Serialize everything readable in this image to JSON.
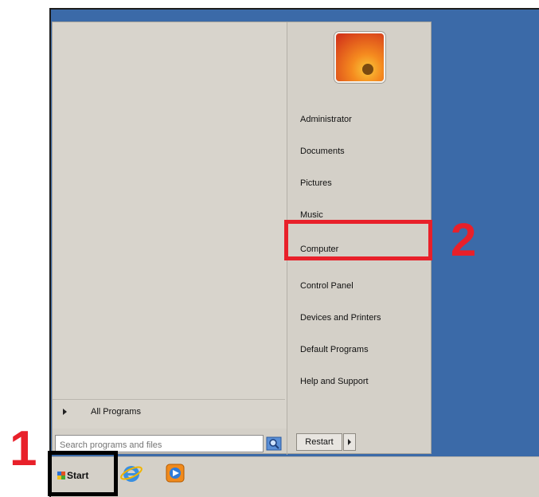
{
  "start_menu": {
    "user_tile_name": "picture-flower",
    "all_programs_label": "All Programs",
    "search_placeholder": "Search programs and files",
    "right_items": [
      {
        "label": "Administrator"
      },
      {
        "label": "Documents"
      },
      {
        "label": "Pictures"
      },
      {
        "label": "Music"
      },
      {
        "label": "Computer"
      },
      {
        "label": "Control Panel"
      },
      {
        "label": "Devices and Printers"
      },
      {
        "label": "Default Programs"
      },
      {
        "label": "Help and Support"
      }
    ],
    "restart_label": "Restart"
  },
  "taskbar": {
    "start_label": "Start",
    "pinned_icons": [
      "internet-explorer-icon",
      "media-player-icon"
    ]
  },
  "annotations": {
    "step1": "1",
    "step2": "2",
    "step1_color": "#000000",
    "step2_color": "#e8202a"
  },
  "colors": {
    "desktop": "#3b6aa8",
    "menu": "#d4d0c8"
  }
}
